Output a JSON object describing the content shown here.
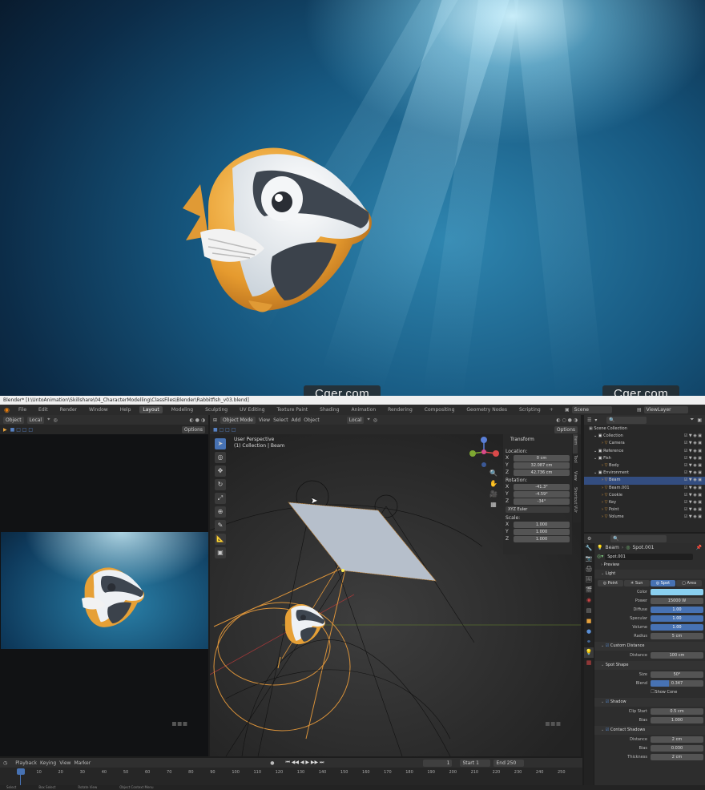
{
  "watermark": "Cger.com",
  "titlebar": "Blender* [I:\\UntoAnimation\\Skillshare\\04_CharacterModelling\\ClassFiles\\Blender\\Rabbitfish_v03.blend]",
  "menu": [
    "File",
    "Edit",
    "Render",
    "Window",
    "Help"
  ],
  "workspaces": [
    "Layout",
    "Modeling",
    "Sculpting",
    "UV Editing",
    "Texture Paint",
    "Shading",
    "Animation",
    "Rendering",
    "Compositing",
    "Geometry Nodes",
    "Scripting"
  ],
  "active_workspace": "Layout",
  "scene": "Scene",
  "view_layer": "ViewLayer",
  "left_header": {
    "mode": "Object",
    "transform": "Local",
    "options": "Options"
  },
  "viewport": {
    "mode": "Object Mode",
    "menus": [
      "View",
      "Select",
      "Add",
      "Object"
    ],
    "transform": "Local",
    "options": "Options",
    "overlay_title": "User Perspective",
    "overlay_sub": "(1) Collection | Beam"
  },
  "transform_panel": {
    "title": "Transform",
    "location_label": "Location:",
    "location": [
      {
        "axis": "X",
        "value": "0 cm"
      },
      {
        "axis": "Y",
        "value": "32.087 cm"
      },
      {
        "axis": "Z",
        "value": "42.736 cm"
      }
    ],
    "rotation_label": "Rotation:",
    "rotation": [
      {
        "axis": "X",
        "value": "-41.3°"
      },
      {
        "axis": "Y",
        "value": "-4.59°"
      },
      {
        "axis": "Z",
        "value": "-34°"
      }
    ],
    "rotation_mode": "XYZ Euler",
    "scale_label": "Scale:",
    "scale": [
      {
        "axis": "X",
        "value": "1.000"
      },
      {
        "axis": "Y",
        "value": "1.000"
      },
      {
        "axis": "Z",
        "value": "1.000"
      }
    ]
  },
  "side_tabs": [
    "Item",
    "Tool",
    "View",
    "Shortcut VUr"
  ],
  "outliner": {
    "root": "Scene Collection",
    "rows": [
      {
        "name": "Collection",
        "depth": 0
      },
      {
        "name": "Camera",
        "depth": 1
      },
      {
        "name": "Reference",
        "depth": 0
      },
      {
        "name": "Fish",
        "depth": 0
      },
      {
        "name": "Body",
        "depth": 1
      },
      {
        "name": "Environment",
        "depth": 0
      },
      {
        "name": "Beam",
        "depth": 1
      },
      {
        "name": "Beam.001",
        "depth": 1
      },
      {
        "name": "Cookie",
        "depth": 1
      },
      {
        "name": "Key",
        "depth": 1
      },
      {
        "name": "Point",
        "depth": 1
      },
      {
        "name": "Volume",
        "depth": 1
      }
    ],
    "selected": "Beam"
  },
  "properties": {
    "object": "Beam",
    "data": "Spot.001",
    "datablock": "Spot.001",
    "preview": "Preview",
    "light": "Light",
    "light_types": [
      "Point",
      "Sun",
      "Spot",
      "Area"
    ],
    "active_type": "Spot",
    "color_label": "Color",
    "color": "#8ad0f0",
    "rows": [
      {
        "label": "Power",
        "value": "15000 W",
        "blue": false
      },
      {
        "label": "Diffuse",
        "value": "1.00",
        "blue": true
      },
      {
        "label": "Specular",
        "value": "1.00",
        "blue": true
      },
      {
        "label": "Volume",
        "value": "1.00",
        "blue": true
      },
      {
        "label": "Radius",
        "value": "5 cm",
        "blue": false
      }
    ],
    "custom_distance": "Custom Distance",
    "distance_label": "Distance",
    "distance": "100 cm",
    "spot_shape": "Spot Shape",
    "size_label": "Size",
    "size": "50°",
    "blend_label": "Blend",
    "blend": "0.347",
    "show_cone": "Show Cone",
    "shadow": "Shadow",
    "clip_start_label": "Clip Start",
    "clip_start": "0.5 cm",
    "bias_label": "Bias",
    "bias": "1.000",
    "contact_shadows": "Contact Shadows",
    "cs_rows": [
      {
        "label": "Distance",
        "value": "2 cm"
      },
      {
        "label": "Bias",
        "value": "0.030"
      },
      {
        "label": "Thickness",
        "value": "2 cm"
      }
    ]
  },
  "timeline": {
    "menus": [
      "Playback",
      "Keying",
      "View",
      "Marker"
    ],
    "current": "1",
    "start_label": "Start",
    "start": "1",
    "end_label": "End",
    "end": "250",
    "ticks": [
      "1",
      "10",
      "20",
      "30",
      "40",
      "50",
      "60",
      "70",
      "80",
      "90",
      "100",
      "110",
      "120",
      "130",
      "140",
      "150",
      "160",
      "170",
      "180",
      "190",
      "200",
      "210",
      "220",
      "230",
      "240",
      "250"
    ]
  },
  "statusbar": [
    "Select",
    "Box Select",
    "Rotate View",
    "Object Context Menu"
  ]
}
